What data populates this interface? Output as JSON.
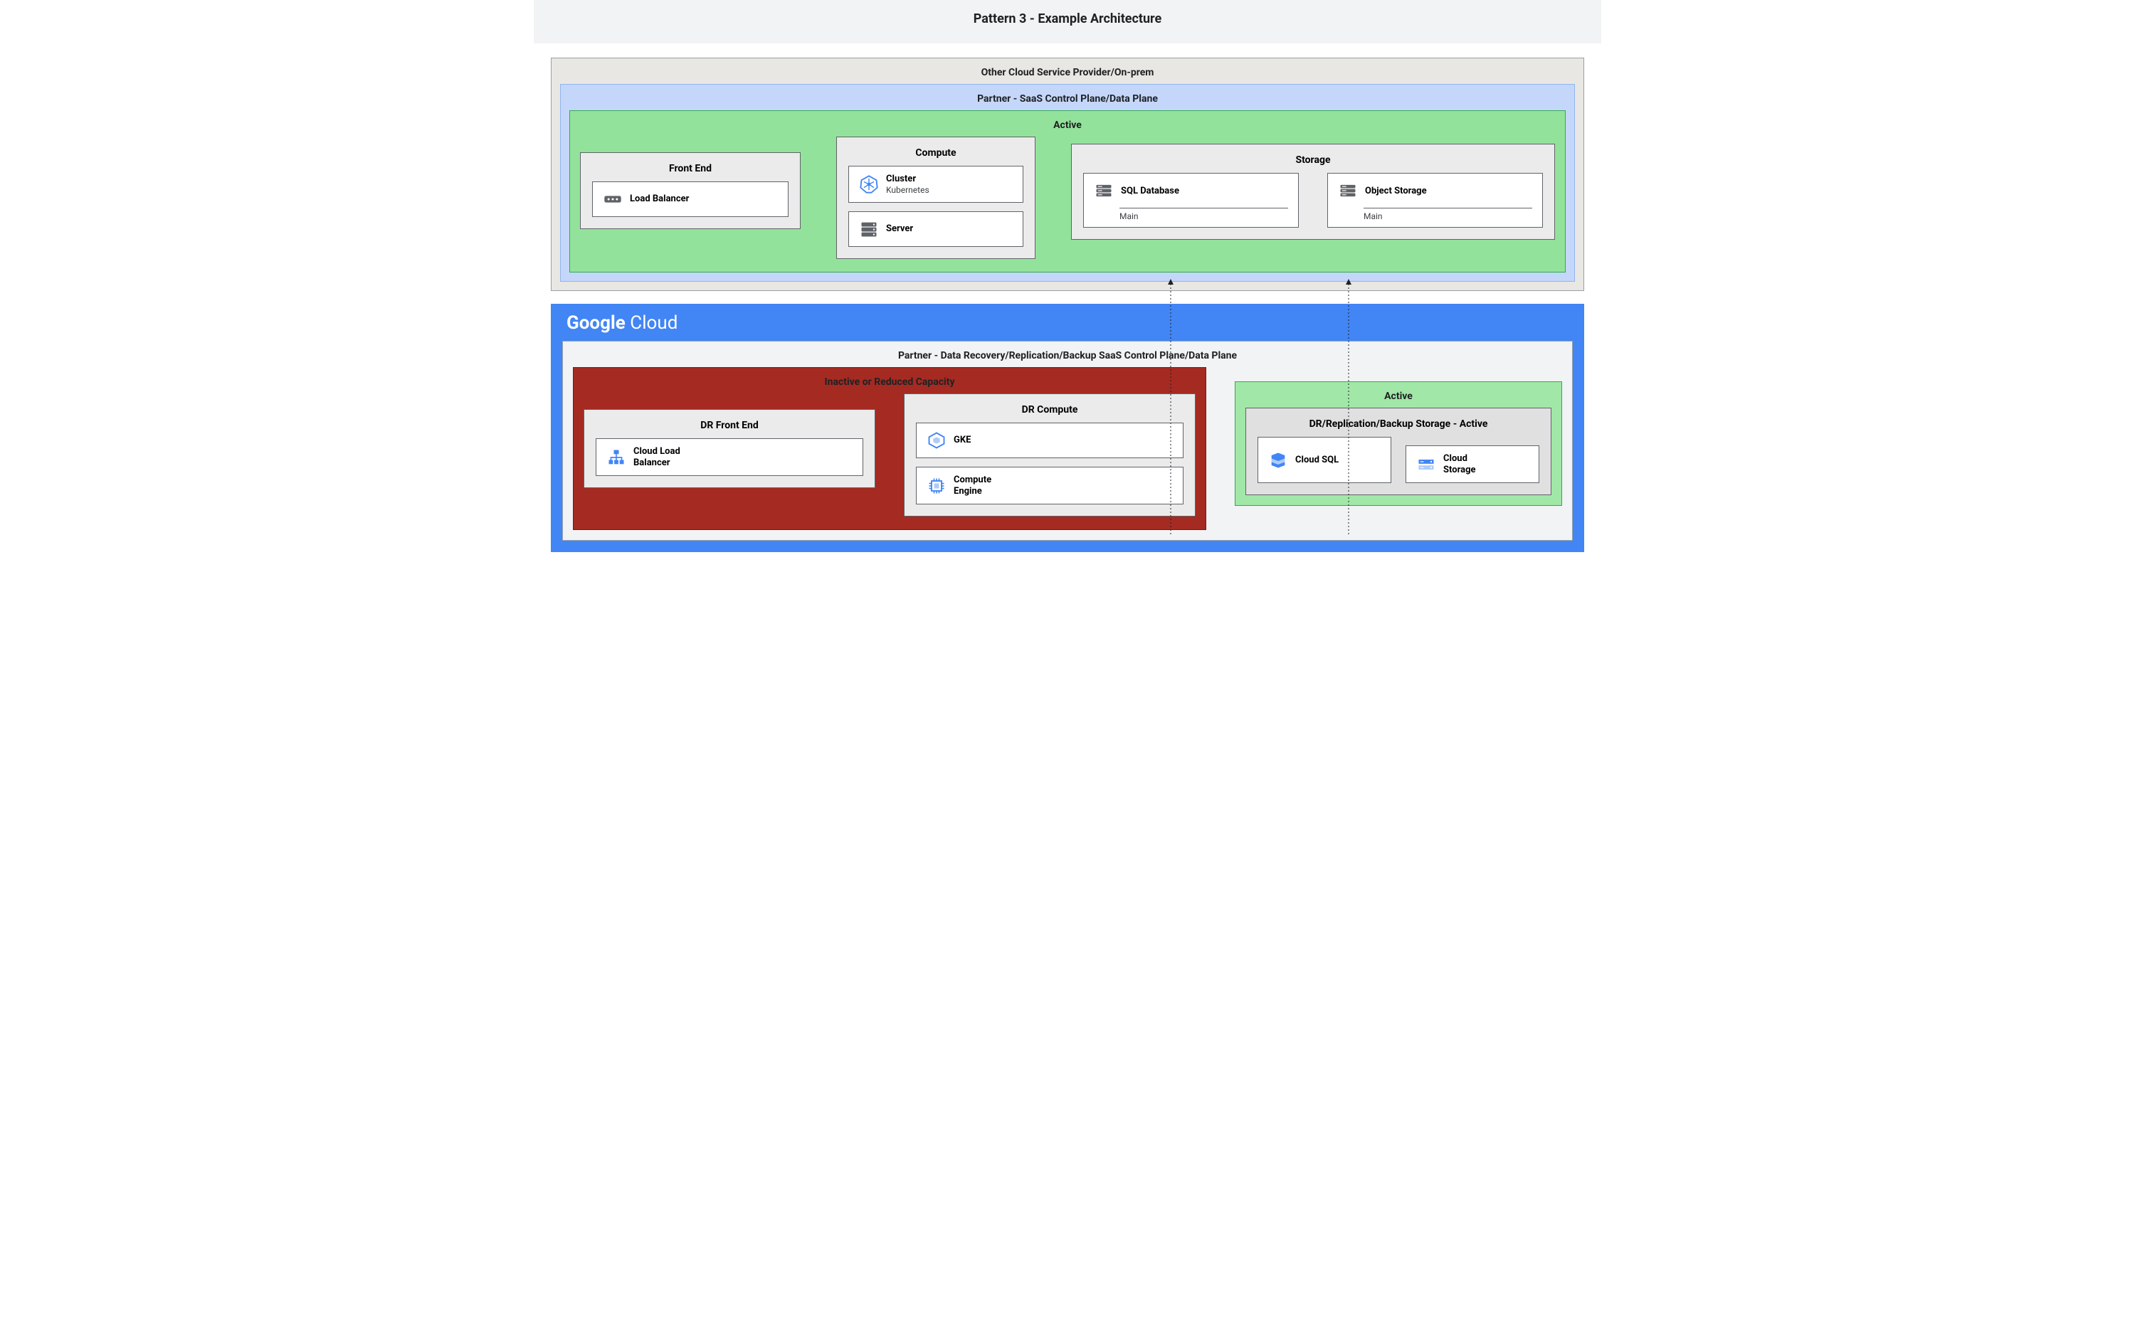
{
  "header": {
    "title": "Pattern 3 - Example Architecture"
  },
  "top": {
    "outer_label": "Other Cloud Service Provider/On-prem",
    "partner_label": "Partner - SaaS Control Plane/Data Plane",
    "active_label": "Active",
    "frontend": {
      "title": "Front End",
      "lb": "Load Balancer"
    },
    "compute": {
      "title": "Compute",
      "cluster_t1": "Cluster",
      "cluster_t2": "Kubernetes",
      "server": "Server"
    },
    "storage": {
      "title": "Storage",
      "sql_name": "SQL Database",
      "sql_sub": "Main",
      "obj_name": "Object Storage",
      "obj_sub": "Main"
    }
  },
  "bottom": {
    "gc_logo_bold": "Google",
    "gc_logo_light": " Cloud",
    "partner_label": "Partner - Data Recovery/Replication/Backup SaaS Control Plane/Data Plane",
    "inactive_label": "Inactive or Reduced Capacity",
    "dr_frontend": {
      "title": "DR Front End",
      "clb_t1": "Cloud Load",
      "clb_t2": "Balancer"
    },
    "dr_compute": {
      "title": "DR Compute",
      "gke": "GKE",
      "ce_t1": "Compute",
      "ce_t2": "Engine"
    },
    "active_label": "Active",
    "dr_storage": {
      "title": "DR/Replication/Backup Storage - Active",
      "csql": "Cloud SQL",
      "cstor_t1": "Cloud",
      "cstor_t2": "Storage"
    }
  }
}
